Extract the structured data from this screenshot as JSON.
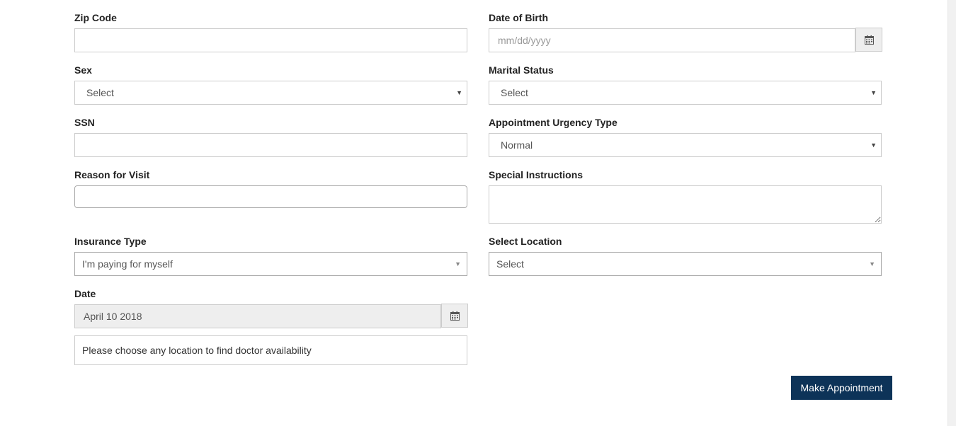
{
  "form": {
    "zip_code": {
      "label": "Zip Code",
      "value": ""
    },
    "date_of_birth": {
      "label": "Date of Birth",
      "placeholder": "mm/dd/yyyy"
    },
    "sex": {
      "label": "Sex",
      "selected": "Select"
    },
    "marital_status": {
      "label": "Marital Status",
      "selected": "Select"
    },
    "ssn": {
      "label": "SSN",
      "value": ""
    },
    "urgency": {
      "label": "Appointment Urgency Type",
      "selected": "Normal"
    },
    "reason": {
      "label": "Reason for Visit",
      "value": ""
    },
    "special_instructions": {
      "label": "Special Instructions",
      "value": ""
    },
    "insurance_type": {
      "label": "Insurance Type",
      "selected": "I'm paying for myself"
    },
    "location": {
      "label": "Select Location",
      "selected": "Select"
    },
    "date": {
      "label": "Date",
      "value": "April 10 2018"
    },
    "availability_message": "Please choose any location to find doctor availability",
    "submit_label": "Make Appointment"
  },
  "icons": {
    "dropdown": "triangle-down",
    "calendar": "calendar-icon"
  },
  "colors": {
    "primary_button": "#0d3358",
    "addon_bg": "#eeeeee",
    "border": "#cccccc"
  }
}
